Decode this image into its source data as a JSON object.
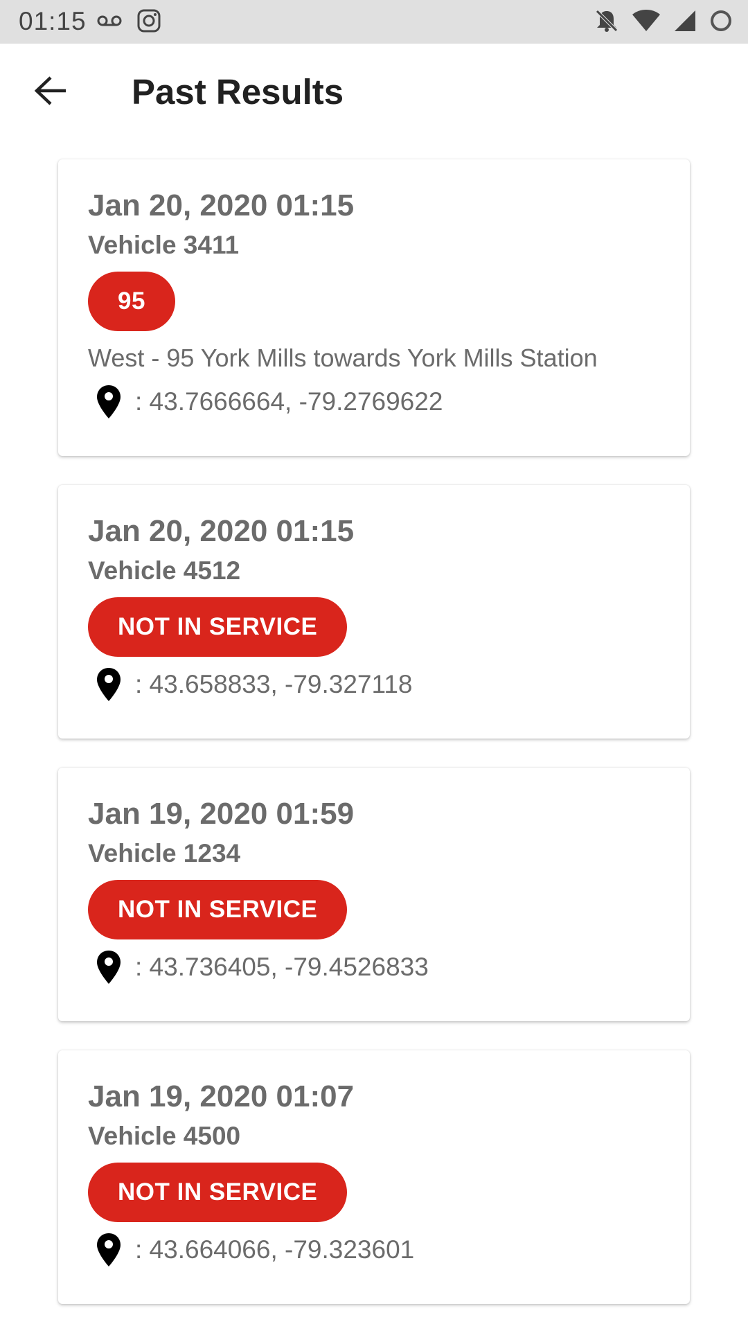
{
  "status_bar": {
    "time": "01:15",
    "left_icons": [
      "voicemail-icon",
      "instagram-icon"
    ],
    "right_icons": [
      "notifications-off-icon",
      "wifi-icon",
      "cell-signal-icon",
      "loading-circle-icon"
    ]
  },
  "app_bar": {
    "title": "Past Results",
    "back_icon": "arrow-back-icon"
  },
  "colors": {
    "badge": "#d9251c",
    "text_secondary": "#6b6b6b",
    "status_bar_bg": "#e0e0e0"
  },
  "results": [
    {
      "date": "Jan 20, 2020 01:15",
      "vehicle": "Vehicle 3411",
      "badge": "95",
      "description": "West - 95 York Mills towards York Mills Station",
      "coords": ": 43.7666664, -79.2769622"
    },
    {
      "date": "Jan 20, 2020 01:15",
      "vehicle": "Vehicle 4512",
      "badge": "NOT IN SERVICE",
      "coords": ": 43.658833, -79.327118"
    },
    {
      "date": "Jan 19, 2020 01:59",
      "vehicle": "Vehicle 1234",
      "badge": "NOT IN SERVICE",
      "coords": ": 43.736405, -79.4526833"
    },
    {
      "date": "Jan 19, 2020 01:07",
      "vehicle": "Vehicle 4500",
      "badge": "NOT IN SERVICE",
      "coords": ": 43.664066, -79.323601"
    }
  ]
}
